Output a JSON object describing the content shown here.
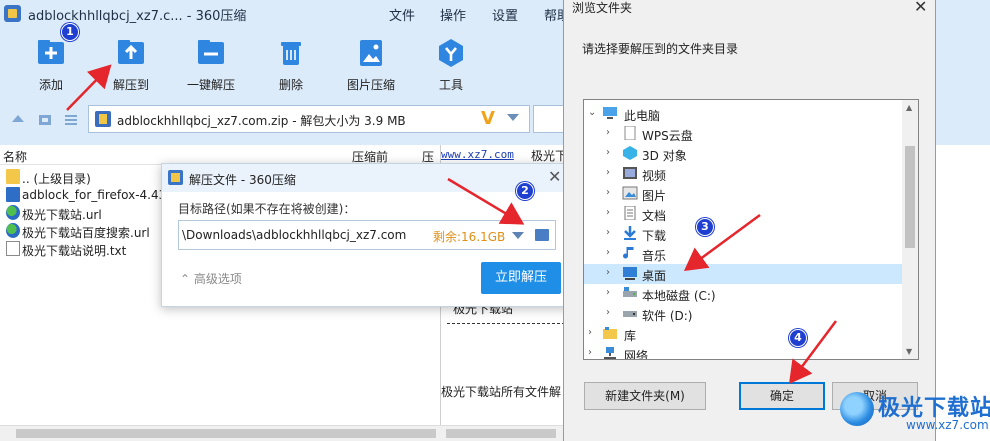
{
  "app": {
    "title": "adblockhhllqbcj_xz7.c... - 360压缩",
    "menu": [
      "文件",
      "操作",
      "设置",
      "帮助"
    ],
    "toolbar": [
      "添加",
      "解压到",
      "一键解压",
      "删除",
      "图片压缩",
      "工具"
    ],
    "address": "adblockhhllqbcj_xz7.com.zip - 解包大小为 3.9 MB",
    "columns": {
      "name": "名称",
      "compressed_before": "压缩前",
      "compressed_after": "压"
    },
    "files": [
      ".. (上级目录)",
      "adblock_for_firefox-4.43",
      "极光下载站.url",
      "极光下载站百度搜索.url",
      "极光下载站说明.txt"
    ],
    "preview": {
      "link": "www.xz7.com",
      "text_top": "极光下",
      "text_mid": "极光下载站",
      "text_bottom": "极光下载站所有文件解"
    }
  },
  "extract_dialog": {
    "title": "解压文件 - 360压缩",
    "close": "✕",
    "path_label": "目标路径(如果不存在将被创建)：",
    "path_value": "\\Downloads\\adblockhhllqbcj_xz7.com",
    "free_space": "剩余:16.1GB",
    "advanced": "高级选项",
    "submit": "立即解压"
  },
  "browse_dialog": {
    "title": "浏览文件夹",
    "close": "✕",
    "description": "请选择要解压到的文件夹目录",
    "tree": [
      "此电脑",
      "WPS云盘",
      "3D 对象",
      "视频",
      "图片",
      "文档",
      "下载",
      "音乐",
      "桌面",
      "本地磁盘 (C:)",
      "软件 (D:)",
      "库",
      "网络"
    ],
    "new_folder": "新建文件夹(M)",
    "ok": "确定",
    "cancel": "取消"
  },
  "annotations": {
    "badges": [
      "1",
      "2",
      "3",
      "4"
    ],
    "arrow_color": "#e5262d"
  },
  "watermark": {
    "brand": "极光下载站",
    "url": "www.xz7.com"
  },
  "colors": {
    "accent": "#1f8ee6",
    "badge": "#1f3fd0",
    "free_space": "#e08f17"
  }
}
